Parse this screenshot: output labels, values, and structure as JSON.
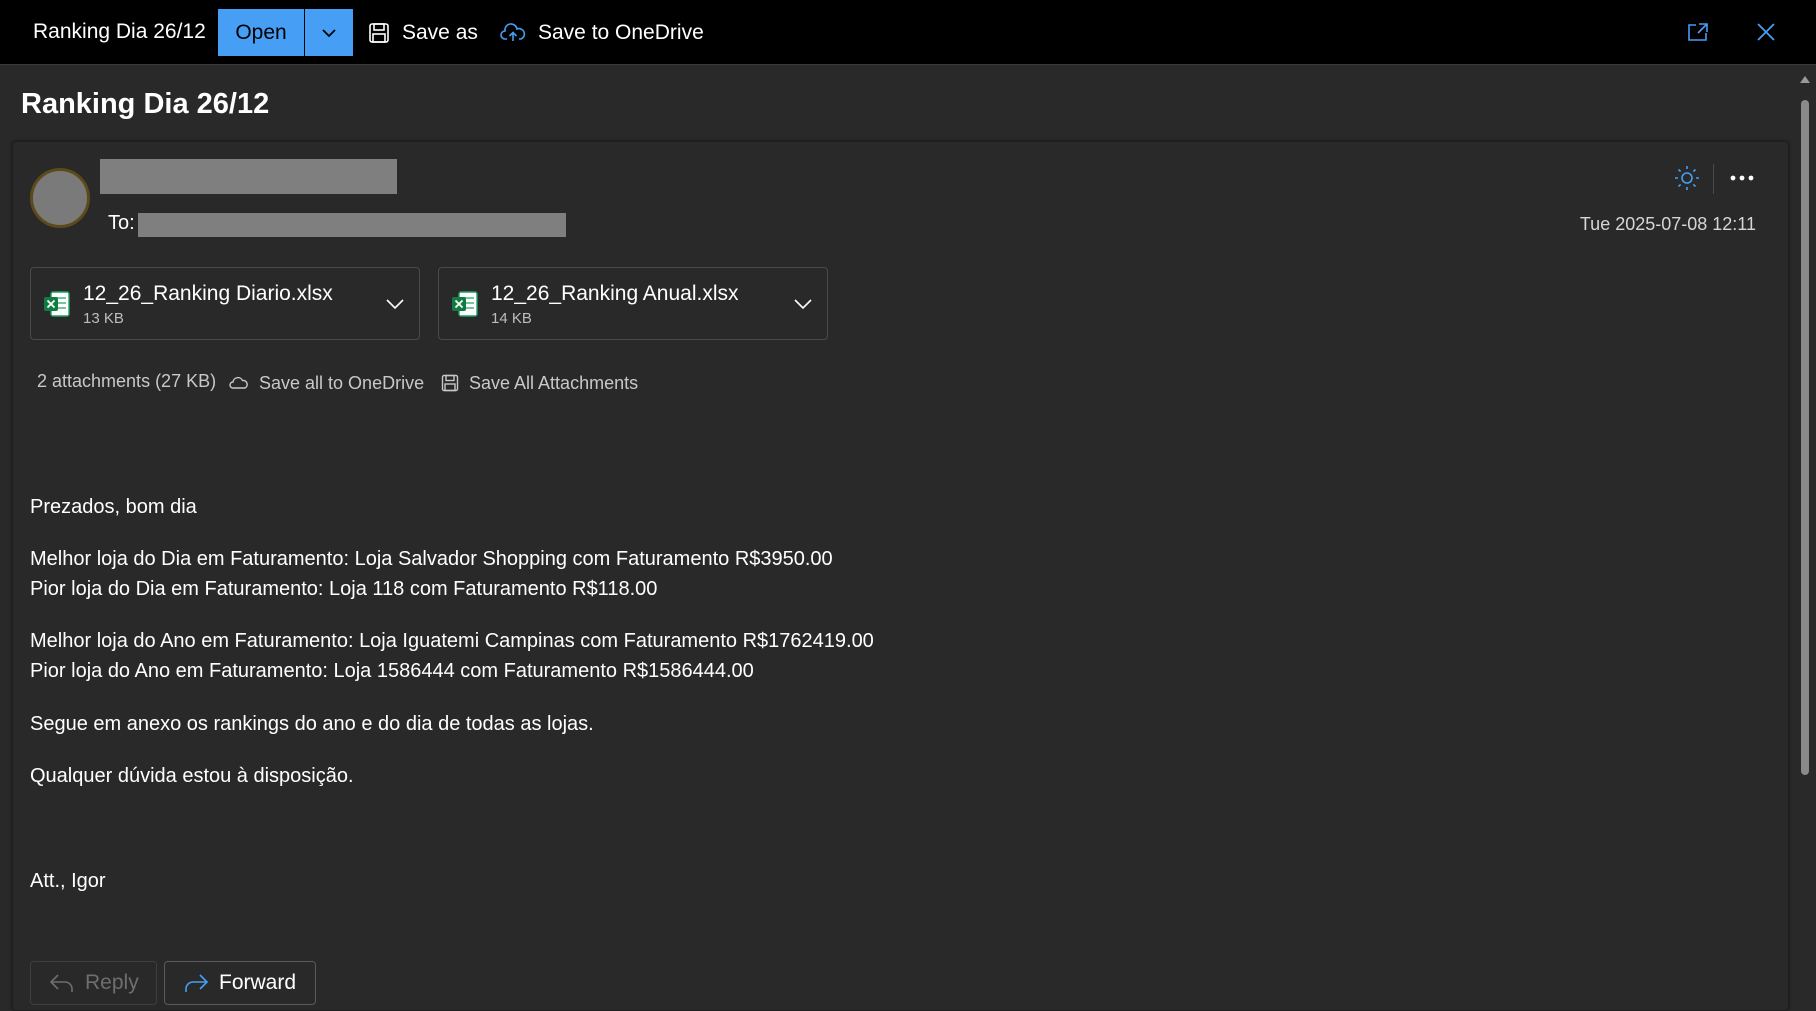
{
  "toolbar": {
    "title": "Ranking Dia 26/12",
    "open_label": "Open",
    "save_as_label": "Save as",
    "save_onedrive_label": "Save to OneDrive"
  },
  "message": {
    "subject": "Ranking Dia 26/12",
    "to_label": "To:",
    "date": "Tue 2025-07-08 12:11"
  },
  "attachments": [
    {
      "name": "12_26_Ranking Diario.xlsx",
      "size": "13 KB",
      "icon": "excel-file-icon"
    },
    {
      "name": "12_26_Ranking Anual.xlsx",
      "size": "14 KB",
      "icon": "excel-file-icon"
    }
  ],
  "attachment_bar": {
    "summary": "2 attachments (27 KB)",
    "save_all_onedrive": "Save all to OneDrive",
    "save_all_attachments": "Save All Attachments"
  },
  "body": {
    "greeting": "Prezados, bom dia",
    "best_day": "Melhor loja do Dia em Faturamento: Loja Salvador Shopping com Faturamento R$3950.00",
    "worst_day": "Pior loja do Dia em Faturamento: Loja 118 com Faturamento R$118.00",
    "best_year": "Melhor loja do Ano em Faturamento: Loja Iguatemi Campinas com Faturamento R$1762419.00",
    "worst_year": "Pior loja do Ano em Faturamento: Loja 1586444 com Faturamento R$1586444.00",
    "attachments_note": "Segue em anexo os rankings do ano e do dia de todas as lojas.",
    "closing": "Qualquer dúvida estou à disposição.",
    "signature": "Att., Igor"
  },
  "actions": {
    "reply_label": "Reply",
    "forward_label": "Forward"
  },
  "colors": {
    "accent": "#479ef5",
    "background": "#292929",
    "toolbar": "#000000",
    "excel_green": "#21a366"
  }
}
